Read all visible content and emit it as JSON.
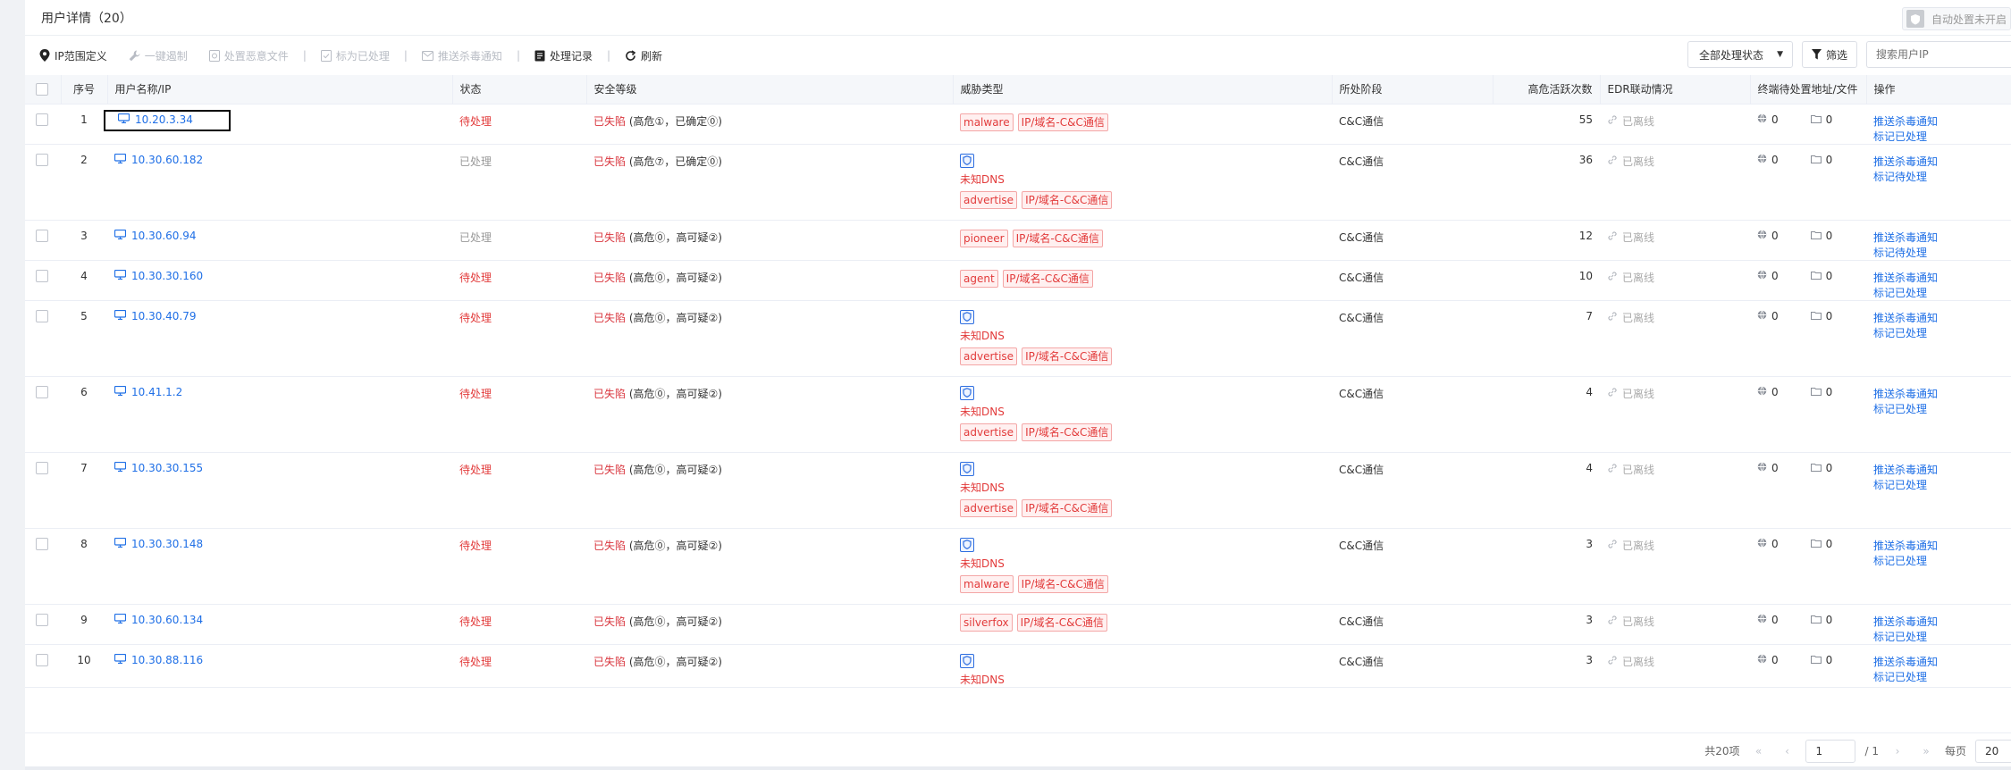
{
  "header": {
    "title": "用户详情（20）",
    "auto_switch_label": "自动处置未开启"
  },
  "toolbar": {
    "ip_range": "IP范围定义",
    "one_click": "一键遏制",
    "handle_file": "处置恶意文件",
    "mark_handled": "标为已处理",
    "push_notice": "推送杀毒通知",
    "records": "处理记录",
    "refresh": "刷新",
    "status_select": "全部处理状态",
    "filter": "筛选",
    "search_placeholder": "搜索用户IP"
  },
  "columns": {
    "index": "序号",
    "user": "用户名称/IP",
    "status": "状态",
    "security": "安全等级",
    "threat": "威胁类型",
    "stage": "所处阶段",
    "active": "高危活跃次数",
    "edr": "EDR联动情况",
    "endpoint": "终端待处置地址/文件",
    "ops": "操作"
  },
  "rows": [
    {
      "idx": "1",
      "ip": "10.20.3.34",
      "status": "待处理",
      "sec_a": "已失陷",
      "sec_b": " (高危①，已确定⓪)",
      "dns": false,
      "dns_label": "",
      "tags": [
        "malware",
        "IP/域名-C&C通信"
      ],
      "stage": "C&C通信",
      "active": "55",
      "edr": "已离线",
      "c1": "0",
      "c2": "0",
      "op1": "推送杀毒通知",
      "op2": "标记已处理"
    },
    {
      "idx": "2",
      "ip": "10.30.60.182",
      "status": "已处理",
      "sec_a": "已失陷",
      "sec_b": " (高危⑦，已确定⓪)",
      "dns": true,
      "dns_label": "未知DNS",
      "tags": [
        "advertise",
        "IP/域名-C&C通信"
      ],
      "stage": "C&C通信",
      "active": "36",
      "edr": "已离线",
      "c1": "0",
      "c2": "0",
      "op1": "推送杀毒通知",
      "op2": "标记待处理"
    },
    {
      "idx": "3",
      "ip": "10.30.60.94",
      "status": "已处理",
      "sec_a": "已失陷",
      "sec_b": " (高危⓪，高可疑②)",
      "dns": false,
      "dns_label": "",
      "tags": [
        "pioneer",
        "IP/域名-C&C通信"
      ],
      "stage": "C&C通信",
      "active": "12",
      "edr": "已离线",
      "c1": "0",
      "c2": "0",
      "op1": "推送杀毒通知",
      "op2": "标记待处理"
    },
    {
      "idx": "4",
      "ip": "10.30.30.160",
      "status": "待处理",
      "sec_a": "已失陷",
      "sec_b": " (高危⓪，高可疑②)",
      "dns": false,
      "dns_label": "",
      "tags": [
        "agent",
        "IP/域名-C&C通信"
      ],
      "stage": "C&C通信",
      "active": "10",
      "edr": "已离线",
      "c1": "0",
      "c2": "0",
      "op1": "推送杀毒通知",
      "op2": "标记已处理"
    },
    {
      "idx": "5",
      "ip": "10.30.40.79",
      "status": "待处理",
      "sec_a": "已失陷",
      "sec_b": " (高危⓪，高可疑②)",
      "dns": true,
      "dns_label": "未知DNS",
      "tags": [
        "advertise",
        "IP/域名-C&C通信"
      ],
      "stage": "C&C通信",
      "active": "7",
      "edr": "已离线",
      "c1": "0",
      "c2": "0",
      "op1": "推送杀毒通知",
      "op2": "标记已处理"
    },
    {
      "idx": "6",
      "ip": "10.41.1.2",
      "status": "待处理",
      "sec_a": "已失陷",
      "sec_b": " (高危⓪，高可疑②)",
      "dns": true,
      "dns_label": "未知DNS",
      "tags": [
        "advertise",
        "IP/域名-C&C通信"
      ],
      "stage": "C&C通信",
      "active": "4",
      "edr": "已离线",
      "c1": "0",
      "c2": "0",
      "op1": "推送杀毒通知",
      "op2": "标记已处理"
    },
    {
      "idx": "7",
      "ip": "10.30.30.155",
      "status": "待处理",
      "sec_a": "已失陷",
      "sec_b": " (高危⓪，高可疑②)",
      "dns": true,
      "dns_label": "未知DNS",
      "tags": [
        "advertise",
        "IP/域名-C&C通信"
      ],
      "stage": "C&C通信",
      "active": "4",
      "edr": "已离线",
      "c1": "0",
      "c2": "0",
      "op1": "推送杀毒通知",
      "op2": "标记已处理"
    },
    {
      "idx": "8",
      "ip": "10.30.30.148",
      "status": "待处理",
      "sec_a": "已失陷",
      "sec_b": " (高危⓪，高可疑②)",
      "dns": true,
      "dns_label": "未知DNS",
      "tags": [
        "malware",
        "IP/域名-C&C通信"
      ],
      "stage": "C&C通信",
      "active": "3",
      "edr": "已离线",
      "c1": "0",
      "c2": "0",
      "op1": "推送杀毒通知",
      "op2": "标记已处理"
    },
    {
      "idx": "9",
      "ip": "10.30.60.134",
      "status": "待处理",
      "sec_a": "已失陷",
      "sec_b": " (高危⓪，高可疑②)",
      "dns": false,
      "dns_label": "",
      "tags": [
        "silverfox",
        "IP/域名-C&C通信"
      ],
      "stage": "C&C通信",
      "active": "3",
      "edr": "已离线",
      "c1": "0",
      "c2": "0",
      "op1": "推送杀毒通知",
      "op2": "标记已处理"
    },
    {
      "idx": "10",
      "ip": "10.30.88.116",
      "status": "待处理",
      "sec_a": "已失陷",
      "sec_b": " (高危⓪，高可疑②)",
      "dns": true,
      "dns_label": "未知DNS",
      "tags": [],
      "stage": "C&C通信",
      "active": "3",
      "edr": "已离线",
      "c1": "0",
      "c2": "0",
      "op1": "推送杀毒通知",
      "op2": "标记已处理"
    }
  ],
  "pager": {
    "total": "共20项",
    "page": "1",
    "pages": "/ 1",
    "per_page_label": "每页",
    "per_page": "20"
  }
}
